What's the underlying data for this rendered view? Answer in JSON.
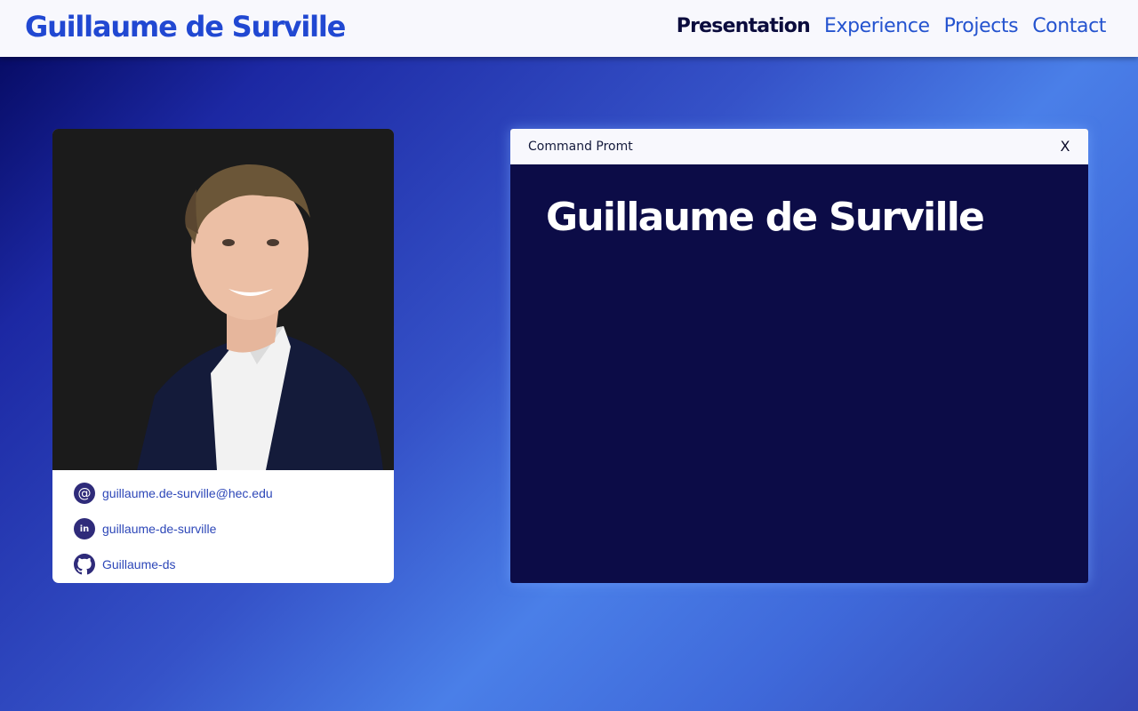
{
  "header": {
    "brand": "Guillaume de Surville",
    "nav": [
      {
        "label": "Presentation",
        "active": true
      },
      {
        "label": "Experience",
        "active": false
      },
      {
        "label": "Projects",
        "active": false
      },
      {
        "label": "Contact",
        "active": false
      }
    ]
  },
  "profile": {
    "photo_alt": "Guillaume de Surville",
    "contacts": [
      {
        "icon": "at-icon",
        "label": "guillaume.de-surville@hec.edu"
      },
      {
        "icon": "linkedin-icon",
        "label": "guillaume-de-surville"
      },
      {
        "icon": "github-icon",
        "label": "Guillaume-ds"
      }
    ]
  },
  "terminal": {
    "title": "Command Promt",
    "close_label": "X",
    "heading": "Guillaume de Surville"
  },
  "colors": {
    "brand": "#2148d2",
    "nav_link": "#2453cf",
    "nav_active": "#0b0c3d",
    "terminal_bg": "#0c0c47",
    "icon_bg": "#2f2b7a"
  }
}
